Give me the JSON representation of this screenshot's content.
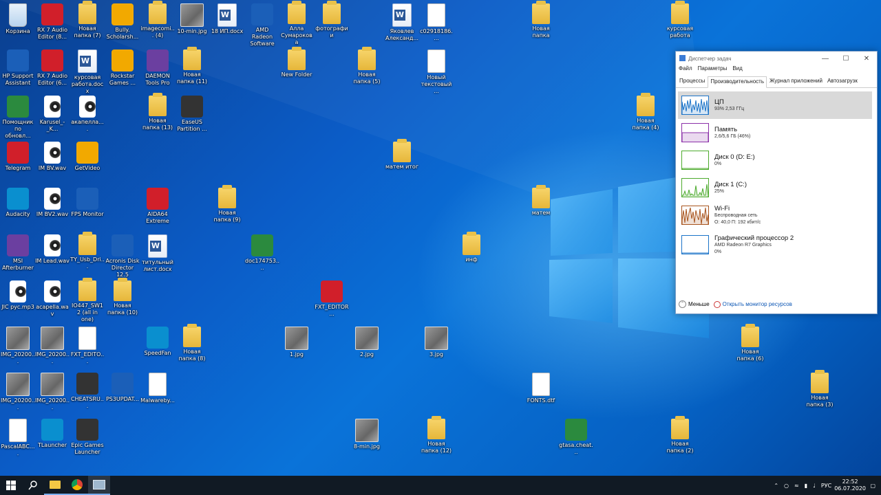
{
  "desktop": {
    "icons": [
      {
        "label": "Корзина",
        "type": "bin"
      },
      {
        "label": "RX 7 Audio Editor (8...",
        "type": "app"
      },
      {
        "label": "Новая папка (7)",
        "type": "folder"
      },
      {
        "label": "Bully. Scholarsh...",
        "type": "app"
      },
      {
        "label": "imagecomi... (4)",
        "type": "folder"
      },
      {
        "label": "10-min.jpg",
        "type": "photo"
      },
      {
        "label": "18 ИП.docx",
        "type": "word"
      },
      {
        "label": "AMD Radeon Software",
        "type": "app"
      },
      {
        "label": "Алла Сумарокова",
        "type": "folder"
      },
      {
        "label": "фотографии",
        "type": "folder"
      },
      {
        "label": "Яковлев Александ...",
        "type": "word"
      },
      {
        "label": "c02918186....",
        "type": "doc"
      },
      {
        "label": "Новая папка",
        "type": "folder"
      },
      {
        "label": "курсовая работа",
        "type": "folder"
      },
      {
        "label": "HP Support Assistant",
        "type": "app"
      },
      {
        "label": "RX 7 Audio Editor (6...",
        "type": "app"
      },
      {
        "label": "курсовая работа.docx",
        "type": "word"
      },
      {
        "label": "Rockstar Games ...",
        "type": "app"
      },
      {
        "label": "DAEMON Tools Pro",
        "type": "app"
      },
      {
        "label": "Новая папка (11)",
        "type": "folder"
      },
      {
        "label": "New Folder",
        "type": "folder"
      },
      {
        "label": "Новая папка (5)",
        "type": "folder"
      },
      {
        "label": "Новый текстовый ...",
        "type": "doc"
      },
      {
        "label": "Помощник по обновл...",
        "type": "app"
      },
      {
        "label": "Karusel_-_K...",
        "type": "audio"
      },
      {
        "label": "акапелла....",
        "type": "audio"
      },
      {
        "label": "Новая папка (13)",
        "type": "folder"
      },
      {
        "label": "EaseUS Partition ...",
        "type": "app"
      },
      {
        "label": "Новая папка (4)",
        "type": "folder"
      },
      {
        "label": "Telegram",
        "type": "app"
      },
      {
        "label": "IM BV.wav",
        "type": "audio"
      },
      {
        "label": "GetVideo",
        "type": "app"
      },
      {
        "label": "матем итог",
        "type": "folder"
      },
      {
        "label": "Audacity",
        "type": "app"
      },
      {
        "label": "IM BV2.wav",
        "type": "audio"
      },
      {
        "label": "FPS Monitor",
        "type": "app"
      },
      {
        "label": "AIDA64 Extreme",
        "type": "app"
      },
      {
        "label": "Новая папка (9)",
        "type": "folder"
      },
      {
        "label": "матем",
        "type": "folder"
      },
      {
        "label": "MSI Afterburner",
        "type": "app"
      },
      {
        "label": "IM Lead.wav",
        "type": "audio"
      },
      {
        "label": "TY_Usb_Dri...",
        "type": "folder"
      },
      {
        "label": "Acronis Disk Director 12.5",
        "type": "app"
      },
      {
        "label": "титульный лист.docx",
        "type": "word"
      },
      {
        "label": "doc174753....",
        "type": "app"
      },
      {
        "label": "инф",
        "type": "folder"
      },
      {
        "label": "JIC рус.mp3",
        "type": "audio"
      },
      {
        "label": "acapella.wav",
        "type": "audio"
      },
      {
        "label": "IO447_SW12 (all in one)",
        "type": "folder"
      },
      {
        "label": "Новая папка (10)",
        "type": "folder"
      },
      {
        "label": "FXT_EDITOR...",
        "type": "app"
      },
      {
        "label": "IMG_20200...",
        "type": "photo"
      },
      {
        "label": "IMG_20200...",
        "type": "photo"
      },
      {
        "label": "FXT_EDITO...",
        "type": "doc"
      },
      {
        "label": "SpeedFan",
        "type": "app"
      },
      {
        "label": "Новая папка (8)",
        "type": "folder"
      },
      {
        "label": "1.jpg",
        "type": "photo"
      },
      {
        "label": "2.jpg",
        "type": "photo"
      },
      {
        "label": "3.jpg",
        "type": "photo"
      },
      {
        "label": "Новая папка (6)",
        "type": "folder"
      },
      {
        "label": "IMG_20200...",
        "type": "photo"
      },
      {
        "label": "IMG_20200...",
        "type": "photo"
      },
      {
        "label": "CHEATSRU...",
        "type": "app"
      },
      {
        "label": "PS3UPDAT...",
        "type": "app"
      },
      {
        "label": "Malwareby...",
        "type": "doc"
      },
      {
        "label": "FONTS.dtf",
        "type": "doc"
      },
      {
        "label": "Новая папка (3)",
        "type": "folder"
      },
      {
        "label": "PascalABC....",
        "type": "doc"
      },
      {
        "label": "TLauncher",
        "type": "app"
      },
      {
        "label": "Epic Games Launcher",
        "type": "app"
      },
      {
        "label": "8-min.jpg",
        "type": "photo"
      },
      {
        "label": "Новая папка (12)",
        "type": "folder"
      },
      {
        "label": "gtasa.cheat...",
        "type": "app"
      },
      {
        "label": "Новая папка (2)",
        "type": "folder"
      }
    ]
  },
  "taskmgr": {
    "title": "Диспетчер задач",
    "menu": [
      "Файл",
      "Параметры",
      "Вид"
    ],
    "tabs": [
      "Процессы",
      "Производительность",
      "Журнал приложений",
      "Автозагрузк"
    ],
    "active_tab": "Производительность",
    "rows": [
      {
        "name": "ЦП",
        "sub1": "93% 2,53 ГГц",
        "sub2": "",
        "color": "#1a73c8",
        "selected": true
      },
      {
        "name": "Память",
        "sub1": "2,6/5,6 ГБ (46%)",
        "sub2": "",
        "color": "#8b2fa8",
        "selected": false
      },
      {
        "name": "Диск 0 (D: E:)",
        "sub1": "0%",
        "sub2": "",
        "color": "#4caa2c",
        "selected": false
      },
      {
        "name": "Диск 1 (C:)",
        "sub1": "25%",
        "sub2": "",
        "color": "#4caa2c",
        "selected": false
      },
      {
        "name": "Wi-Fi",
        "sub1": "Беспроводная сеть",
        "sub2": "О: 40,0 П: 192 кбит/с",
        "color": "#a7521b",
        "selected": false
      },
      {
        "name": "Графический процессор 2",
        "sub1": "AMD Radeon R7 Graphics",
        "sub2": "0%",
        "color": "#1a73c8",
        "selected": false
      }
    ],
    "less_label": "Меньше",
    "monitor_label": "Открыть монитор ресурсов"
  },
  "taskbar": {
    "lang": "РУС",
    "time": "22:52",
    "date": "06.07.2020"
  }
}
